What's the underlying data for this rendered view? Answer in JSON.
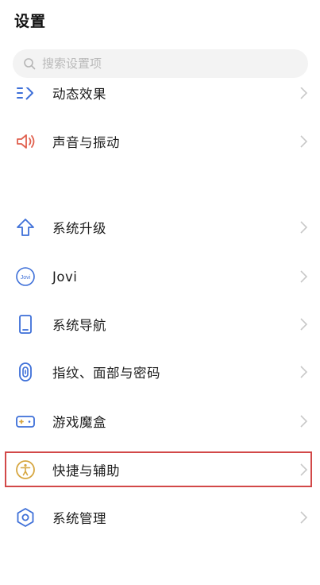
{
  "header": {
    "title": "设置",
    "search_placeholder": "搜索设置项"
  },
  "items": [
    {
      "label": "动态效果",
      "icon": "dynamic-effect-icon"
    },
    {
      "label": "声音与振动",
      "icon": "speaker-icon"
    },
    {
      "label": "系统升级",
      "icon": "upgrade-arrow-icon"
    },
    {
      "label": "Jovi",
      "icon": "jovi-icon",
      "icon_text": "Jovi"
    },
    {
      "label": "系统导航",
      "icon": "phone-icon"
    },
    {
      "label": "指纹、面部与密码",
      "icon": "fingerprint-icon"
    },
    {
      "label": "游戏魔盒",
      "icon": "game-box-icon"
    },
    {
      "label": "快捷与辅助",
      "icon": "accessibility-icon",
      "highlighted": true
    },
    {
      "label": "系统管理",
      "icon": "system-management-icon"
    }
  ],
  "colors": {
    "icon_blue": "#3d6fd8",
    "speaker_red": "#e0614f",
    "accessibility_gold": "#d6a640",
    "highlight_red": "#d24848",
    "chevron_gray": "#c8c8c8"
  }
}
